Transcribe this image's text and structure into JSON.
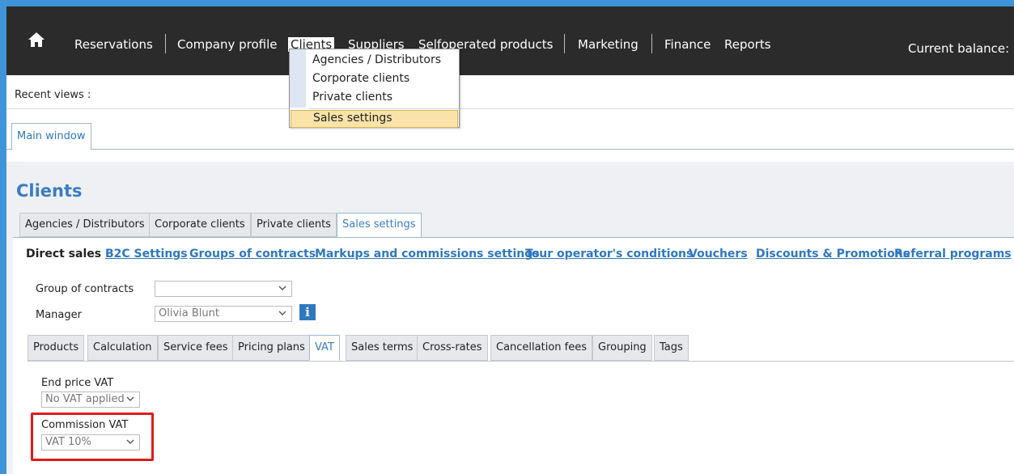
{
  "nav": {
    "items": [
      "Reservations",
      "Company profile",
      "Clients",
      "Suppliers",
      "Selfoperated products",
      "Marketing",
      "Finance",
      "Reports"
    ],
    "balance_label": "Current balance:"
  },
  "recent": {
    "label": "Recent views :"
  },
  "main_tab": "Main window",
  "page_title": "Clients",
  "client_tabs": [
    "Agencies / Distributors",
    "Corporate clients",
    "Private clients",
    "Sales settings"
  ],
  "sublinks": [
    "Direct sales",
    "B2C Settings",
    "Groups of contracts",
    "Markups and commissions settings",
    "Tour operator's conditions",
    "Vouchers",
    "Discounts & Promotions",
    "Referral programs"
  ],
  "form": {
    "group_label": "Group of contracts",
    "group_value": "",
    "manager_label": "Manager",
    "manager_value": "Olivia Blunt",
    "info_glyph": "i"
  },
  "vat_tabs": [
    "Products",
    "Calculation",
    "Service fees",
    "Pricing plans",
    "VAT",
    "Sales terms",
    "Cross-rates",
    "Cancellation fees",
    "Grouping",
    "Tags"
  ],
  "vat": {
    "end_price_label": "End price VAT",
    "end_price_value": "No VAT applied",
    "commission_label": "Commission VAT",
    "commission_value": "VAT 10%"
  },
  "dropdown": {
    "items": [
      "Agencies / Distributors",
      "Corporate clients",
      "Private clients"
    ],
    "selected": "Sales settings"
  },
  "colors": {
    "accent": "#3b7cc3",
    "nav_bg": "#2b2b2b",
    "highlight": "#e01b1b",
    "menu_selected": "#f9e3a8"
  }
}
